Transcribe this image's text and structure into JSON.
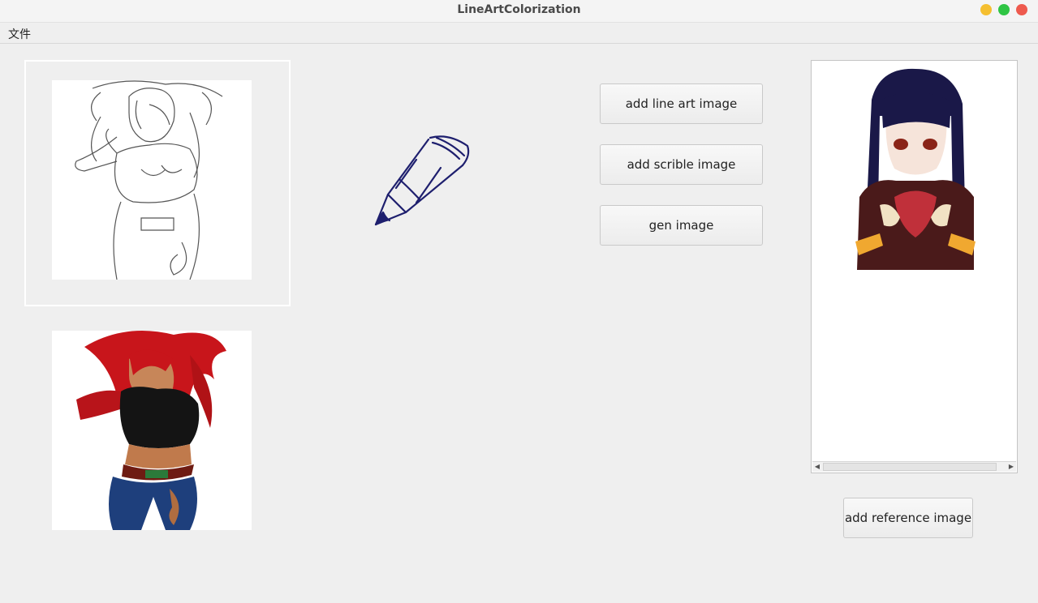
{
  "window": {
    "title": "LineArtColorization"
  },
  "menubar": {
    "items": [
      "文件"
    ]
  },
  "buttons": {
    "add_line_art": "add line art image",
    "add_scrible": "add scrible image",
    "gen_image": "gen image",
    "add_reference": "add reference image"
  },
  "colors": {
    "minimize": "#f5bf30",
    "maximize": "#2fc544",
    "close": "#ee5a4e",
    "pencil": "#1e1f6e"
  },
  "icons": [
    "pencil-icon",
    "scroll-left-icon",
    "scroll-right-icon"
  ]
}
